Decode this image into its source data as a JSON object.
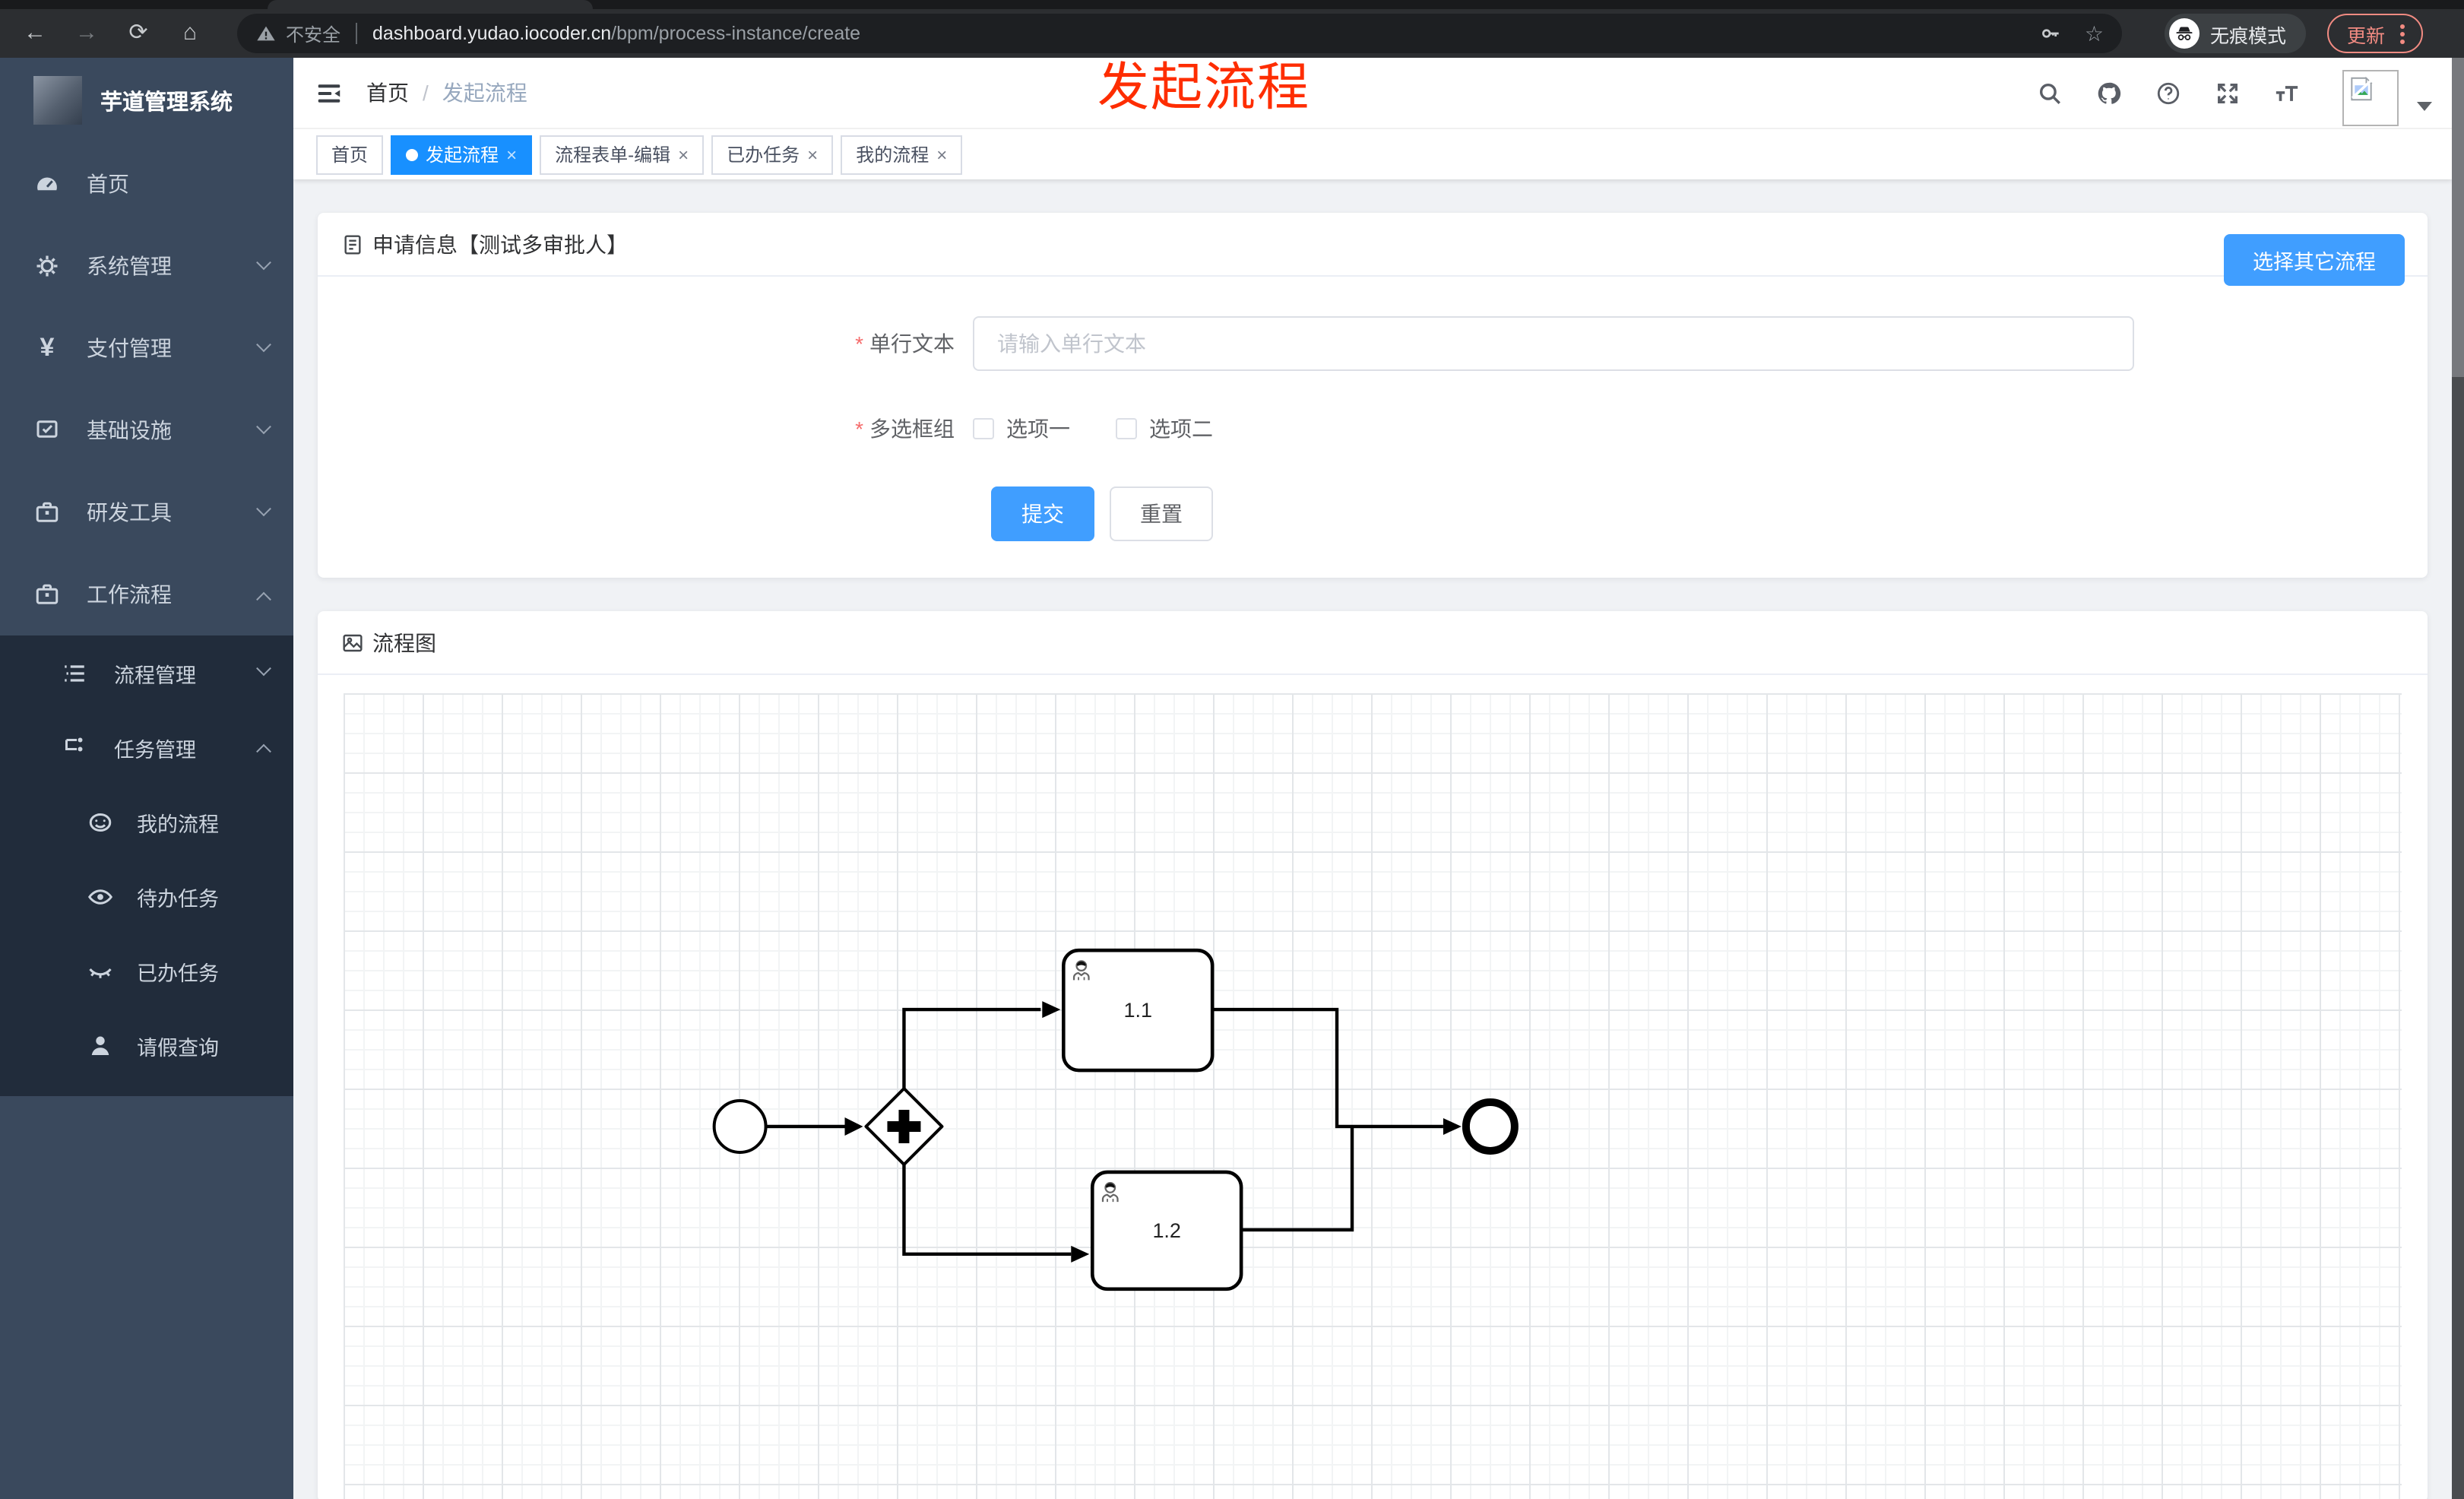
{
  "browser": {
    "security_label": "不安全",
    "url_domain": "dashboard.yudao.iocoder.cn",
    "url_path": "/bpm/process-instance/create",
    "incognito_label": "无痕模式",
    "update_label": "更新"
  },
  "annotation": {
    "text": "发起流程",
    "color": "#fe2d00"
  },
  "sidebar": {
    "title": "芋道管理系统",
    "items": [
      {
        "label": "首页"
      },
      {
        "label": "系统管理"
      },
      {
        "label": "支付管理"
      },
      {
        "label": "基础设施"
      },
      {
        "label": "研发工具"
      },
      {
        "label": "工作流程"
      }
    ],
    "submenu": [
      {
        "label": "流程管理"
      },
      {
        "label": "任务管理"
      },
      {
        "label": "我的流程"
      },
      {
        "label": "待办任务"
      },
      {
        "label": "已办任务"
      },
      {
        "label": "请假查询"
      }
    ]
  },
  "navbar": {
    "breadcrumb_home": "首页",
    "separator": "/",
    "breadcrumb_current": "发起流程"
  },
  "tabs": [
    {
      "label": "首页"
    },
    {
      "label": "发起流程"
    },
    {
      "label": "流程表单-编辑"
    },
    {
      "label": "已办任务"
    },
    {
      "label": "我的流程"
    }
  ],
  "form_card": {
    "title": "申请信息【测试多审批人】",
    "choose_button": "选择其它流程",
    "text_field": {
      "label": "单行文本",
      "placeholder": "请输入单行文本",
      "value": ""
    },
    "checkbox_field": {
      "label": "多选框组",
      "options": [
        "选项一",
        "选项二"
      ]
    },
    "submit_label": "提交",
    "reset_label": "重置"
  },
  "diagram_card": {
    "title": "流程图",
    "tasks": [
      "1.1",
      "1.2"
    ]
  },
  "colors": {
    "accent": "#409eff",
    "tab_active": "#1890ff",
    "annotation_red": "#fe2d00",
    "update_salmon": "#f28b82",
    "sidebar_bg": "#3a495d",
    "submenu_bg": "#212c3b"
  }
}
